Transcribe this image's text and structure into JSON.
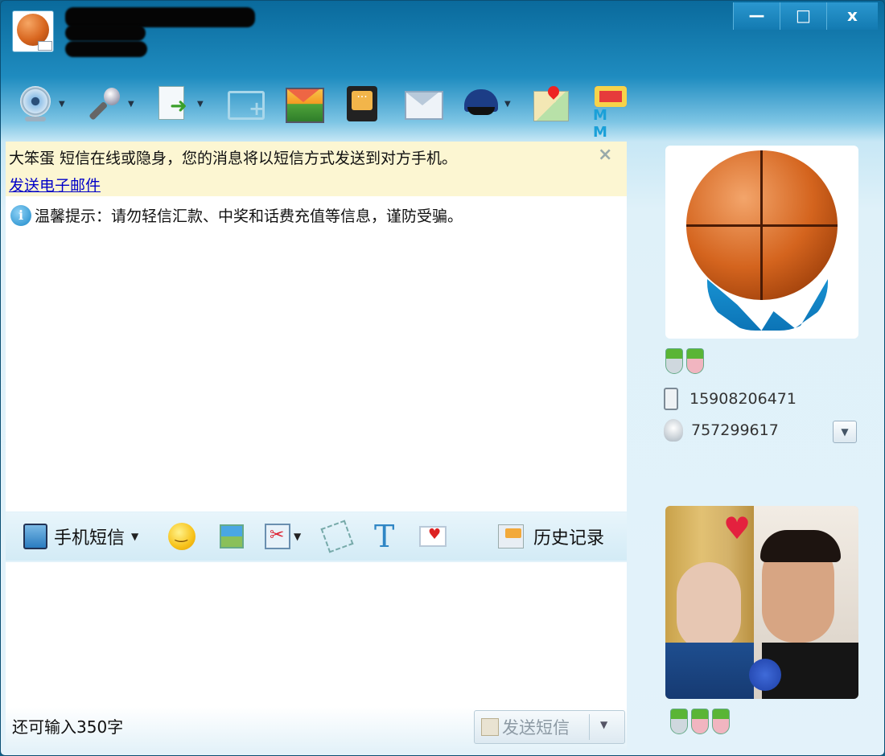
{
  "titlebar": {
    "window_controls": {
      "minimize": "—",
      "maximize": "□",
      "close": "x"
    }
  },
  "toolbar": {
    "items": [
      {
        "icon": "webcam-icon",
        "has_dropdown": true
      },
      {
        "icon": "microphone-icon",
        "has_dropdown": true
      },
      {
        "icon": "send-file-icon",
        "has_dropdown": true
      },
      {
        "icon": "new-chat-icon",
        "has_dropdown": false
      },
      {
        "icon": "photo-icon",
        "has_dropdown": false
      },
      {
        "icon": "tablet-message-icon",
        "has_dropdown": false
      },
      {
        "icon": "mail-icon",
        "has_dropdown": false
      },
      {
        "icon": "police-hat-icon",
        "has_dropdown": true
      },
      {
        "icon": "map-pin-icon",
        "has_dropdown": false
      },
      {
        "icon": "gift-mm-icon",
        "has_dropdown": false
      }
    ]
  },
  "notice": {
    "text": "大笨蛋 短信在线或隐身，您的消息将以短信方式发送到对方手机。",
    "link": "发送电子邮件",
    "close": "×"
  },
  "tip": {
    "icon_text": "i",
    "text": "温馨提示：请勿轻信汇款、中奖和话费充值等信息，谨防受骗。"
  },
  "input_toolbar": {
    "sms_label": "手机短信",
    "history_label": "历史记录"
  },
  "footer": {
    "remaining": "还可输入350字",
    "send_label": "发送短信"
  },
  "contact": {
    "phone": "15908206471",
    "qq": "757299617"
  },
  "colors": {
    "title_blue": "#0a6a9c",
    "notice_bg": "#fcf6d2",
    "link": "#0000c8"
  }
}
